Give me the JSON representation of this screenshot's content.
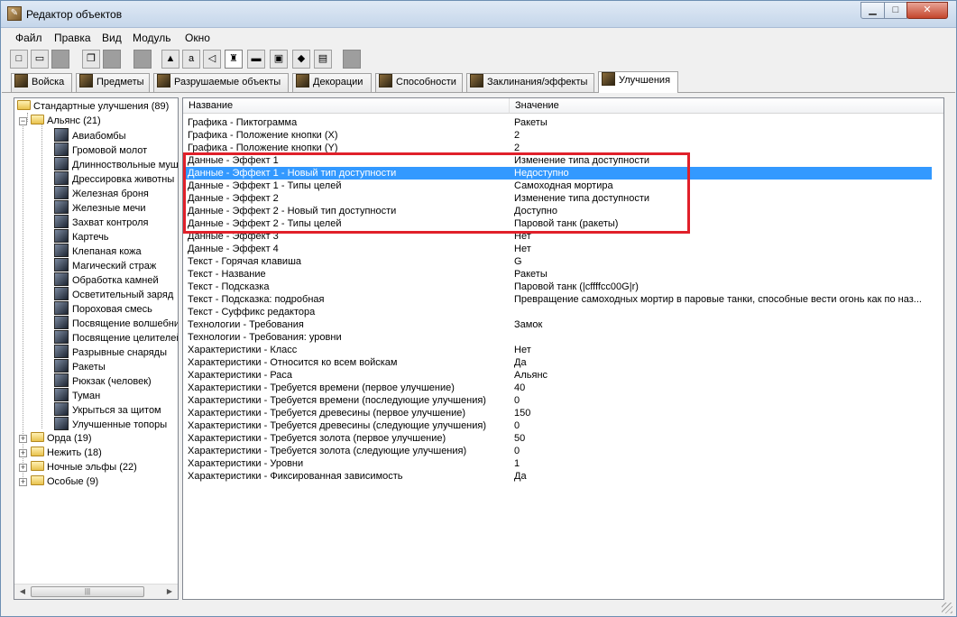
{
  "window": {
    "title": "Редактор объектов"
  },
  "titlebar": {
    "minimize": "▁",
    "maximize": "□",
    "close": "✕"
  },
  "menu": [
    "Файл",
    "Правка",
    "Вид",
    "Модуль",
    "Окно"
  ],
  "tabs": [
    {
      "label": "Войска"
    },
    {
      "label": "Предметы"
    },
    {
      "label": "Разрушаемые объекты"
    },
    {
      "label": "Декорации"
    },
    {
      "label": "Способности"
    },
    {
      "label": "Заклинания/эффекты"
    },
    {
      "label": "Улучшения",
      "active": true
    }
  ],
  "tree": {
    "root": "Стандартные улучшения (89)",
    "alliance": "Альянс (21)",
    "alliance_items": [
      "Авиабомбы",
      "Громовой молот",
      "Длинноствольные муш",
      "Дрессировка животны",
      "Железная броня",
      "Железные мечи",
      "Захват контроля",
      "Картечь",
      "Клепаная кожа",
      "Магический страж",
      "Обработка камней",
      "Осветительный заряд",
      "Пороховая смесь",
      "Посвящение волшебни",
      "Посвящение целителей",
      "Разрывные снаряды",
      "Ракеты",
      "Рюкзак (человек)",
      "Туман",
      "Укрыться за щитом",
      "Улучшенные топоры"
    ],
    "other_groups": [
      "Орда (19)",
      "Нежить (18)",
      "Ночные эльфы (22)",
      "Особые (9)"
    ],
    "expand_symbol": "+",
    "collapse_symbol": "−",
    "scroll_grip": "|||"
  },
  "grid": {
    "columns": [
      "Название",
      "Значение"
    ],
    "selected_index": 4,
    "rows": [
      {
        "name": "Графика - Пиктограмма",
        "value": "Ракеты"
      },
      {
        "name": "Графика - Положение кнопки (X)",
        "value": "2"
      },
      {
        "name": "Графика - Положение кнопки (Y)",
        "value": "2"
      },
      {
        "name": "Данные - Эффект 1",
        "value": "Изменение типа доступности"
      },
      {
        "name": "Данные - Эффект 1 - Новый тип доступности",
        "value": "Недоступно"
      },
      {
        "name": "Данные - Эффект 1 - Типы целей",
        "value": "Самоходная мортира"
      },
      {
        "name": "Данные - Эффект 2",
        "value": "Изменение типа доступности"
      },
      {
        "name": "Данные - Эффект 2 - Новый тип доступности",
        "value": "Доступно"
      },
      {
        "name": "Данные - Эффект 2 - Типы целей",
        "value": "Паровой танк (ракеты)"
      },
      {
        "name": "Данные - Эффект 3",
        "value": "Нет"
      },
      {
        "name": "Данные - Эффект 4",
        "value": "Нет"
      },
      {
        "name": "Текст - Горячая клавиша",
        "value": "G"
      },
      {
        "name": "Текст - Название",
        "value": "Ракеты"
      },
      {
        "name": "Текст - Подсказка",
        "value": "Паровой танк (|cffffcc00G|r)"
      },
      {
        "name": "Текст - Подсказка: подробная",
        "value": "Превращение самоходных мортир в паровые танки, способные вести огонь как по наз..."
      },
      {
        "name": "Текст - Суффикс редактора",
        "value": ""
      },
      {
        "name": "Технологии - Требования",
        "value": "Замок"
      },
      {
        "name": "Технологии - Требования: уровни",
        "value": ""
      },
      {
        "name": "Характеристики - Класс",
        "value": "Нет"
      },
      {
        "name": "Характеристики - Относится ко всем войскам",
        "value": "Да"
      },
      {
        "name": "Характеристики - Раса",
        "value": "Альянс"
      },
      {
        "name": "Характеристики - Требуется времени (первое улучшение)",
        "value": "40"
      },
      {
        "name": "Характеристики - Требуется времени (последующие улучшения)",
        "value": "0"
      },
      {
        "name": "Характеристики - Требуется древесины (первое улучшение)",
        "value": "150"
      },
      {
        "name": "Характеристики - Требуется древесины (следующие улучшения)",
        "value": "0"
      },
      {
        "name": "Характеристики - Требуется золота (первое улучшение)",
        "value": "50"
      },
      {
        "name": "Характеристики - Требуется золота (следующие улучшения)",
        "value": "0"
      },
      {
        "name": "Характеристики - Уровни",
        "value": "1"
      },
      {
        "name": "Характеристики - Фиксированная зависимость",
        "value": "Да"
      }
    ]
  },
  "colors": {
    "selection": "#3399ff",
    "highlight_box": "#e0202a"
  }
}
